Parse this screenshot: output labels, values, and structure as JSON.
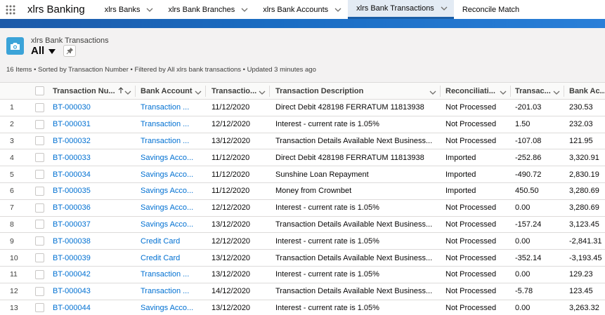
{
  "app": {
    "name": "xlrs Banking"
  },
  "nav": {
    "tabs": [
      {
        "label": "xlrs Banks"
      },
      {
        "label": "xlrs Bank Branches"
      },
      {
        "label": "xlrs Bank Accounts"
      },
      {
        "label": "xlrs Bank Transactions"
      },
      {
        "label": "Reconcile Match"
      }
    ]
  },
  "colors": {
    "accent": "#1b5fa7",
    "link": "#0070d2",
    "object_icon": "#3ba3d8",
    "active_tab": "#e3ebf4"
  },
  "icons": {
    "app_launcher": "waffle-icon",
    "object": "camera-icon",
    "pin": "pin-icon"
  },
  "list_header": {
    "object_label": "xlrs Bank Transactions",
    "view_name": "All",
    "status": "16 Items • Sorted by Transaction Number • Filtered by All xlrs bank transactions • Updated 3 minutes ago"
  },
  "table": {
    "columns": [
      "Transaction Nu...",
      "Bank Account",
      "Transactio...",
      "Transaction Description",
      "Reconciliati...",
      "Transac...",
      "Bank Ac..."
    ],
    "rows": [
      {
        "n": "1",
        "tn": "BT-000030",
        "ba": "Transaction ...",
        "td": "11/12/2020",
        "desc": "Direct Debit 428198 FERRATUM 11813938",
        "rec": "Not Processed",
        "amt": "-201.03",
        "bal": "230.53"
      },
      {
        "n": "2",
        "tn": "BT-000031",
        "ba": "Transaction ...",
        "td": "12/12/2020",
        "desc": "Interest - current rate is 1.05%",
        "rec": "Not Processed",
        "amt": "1.50",
        "bal": "232.03"
      },
      {
        "n": "3",
        "tn": "BT-000032",
        "ba": "Transaction ...",
        "td": "13/12/2020",
        "desc": "Transaction Details Available Next Business...",
        "rec": "Not Processed",
        "amt": "-107.08",
        "bal": "121.95"
      },
      {
        "n": "4",
        "tn": "BT-000033",
        "ba": "Savings Acco...",
        "td": "11/12/2020",
        "desc": "Direct Debit 428198 FERRATUM 11813938",
        "rec": "Imported",
        "amt": "-252.86",
        "bal": "3,320.91"
      },
      {
        "n": "5",
        "tn": "BT-000034",
        "ba": "Savings Acco...",
        "td": "11/12/2020",
        "desc": "Sunshine Loan Repayment",
        "rec": "Imported",
        "amt": "-490.72",
        "bal": "2,830.19"
      },
      {
        "n": "6",
        "tn": "BT-000035",
        "ba": "Savings Acco...",
        "td": "11/12/2020",
        "desc": "Money from Crownbet",
        "rec": "Imported",
        "amt": "450.50",
        "bal": "3,280.69"
      },
      {
        "n": "7",
        "tn": "BT-000036",
        "ba": "Savings Acco...",
        "td": "12/12/2020",
        "desc": "Interest - current rate is 1.05%",
        "rec": "Not Processed",
        "amt": "0.00",
        "bal": "3,280.69"
      },
      {
        "n": "8",
        "tn": "BT-000037",
        "ba": "Savings Acco...",
        "td": "13/12/2020",
        "desc": "Transaction Details Available Next Business...",
        "rec": "Not Processed",
        "amt": "-157.24",
        "bal": "3,123.45"
      },
      {
        "n": "9",
        "tn": "BT-000038",
        "ba": "Credit Card",
        "td": "12/12/2020",
        "desc": "Interest - current rate is 1.05%",
        "rec": "Not Processed",
        "amt": "0.00",
        "bal": "-2,841.31"
      },
      {
        "n": "10",
        "tn": "BT-000039",
        "ba": "Credit Card",
        "td": "13/12/2020",
        "desc": "Transaction Details Available Next Business...",
        "rec": "Not Processed",
        "amt": "-352.14",
        "bal": "-3,193.45"
      },
      {
        "n": "11",
        "tn": "BT-000042",
        "ba": "Transaction ...",
        "td": "13/12/2020",
        "desc": "Interest - current rate is 1.05%",
        "rec": "Not Processed",
        "amt": "0.00",
        "bal": "129.23"
      },
      {
        "n": "12",
        "tn": "BT-000043",
        "ba": "Transaction ...",
        "td": "14/12/2020",
        "desc": "Transaction Details Available Next Business...",
        "rec": "Not Processed",
        "amt": "-5.78",
        "bal": "123.45"
      },
      {
        "n": "13",
        "tn": "BT-000044",
        "ba": "Savings Acco...",
        "td": "13/12/2020",
        "desc": "Interest - current rate is 1.05%",
        "rec": "Not Processed",
        "amt": "0.00",
        "bal": "3,263.32"
      }
    ]
  }
}
